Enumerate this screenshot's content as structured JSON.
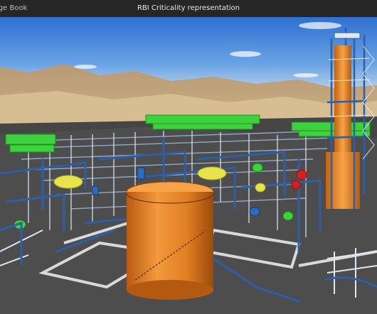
{
  "app": {
    "name": "Page Book",
    "window_title": "RBI Criticality representation"
  },
  "viewport": {
    "description_icon": "3d-plant-model"
  },
  "toolbar": {
    "buttons": [
      {
        "icon": "orbit-icon"
      },
      {
        "icon": "pan-hand-icon"
      },
      {
        "icon": "measure-ruler-icon"
      },
      {
        "icon": "fit-all-icon"
      },
      {
        "icon": "home-icon"
      },
      {
        "icon": "zoom-in-icon"
      },
      {
        "icon": "zoom-out-icon"
      },
      {
        "icon": "fullscreen-icon"
      },
      {
        "icon": "focus-icon"
      },
      {
        "icon": "settings-icon"
      }
    ]
  },
  "colors": {
    "orange_equipment": "#e8822a",
    "green_critical": "#3fd23f",
    "yellow_critical": "#e7e34a",
    "red_critical": "#d52020",
    "pipe_blue": "#2d5fa8"
  }
}
